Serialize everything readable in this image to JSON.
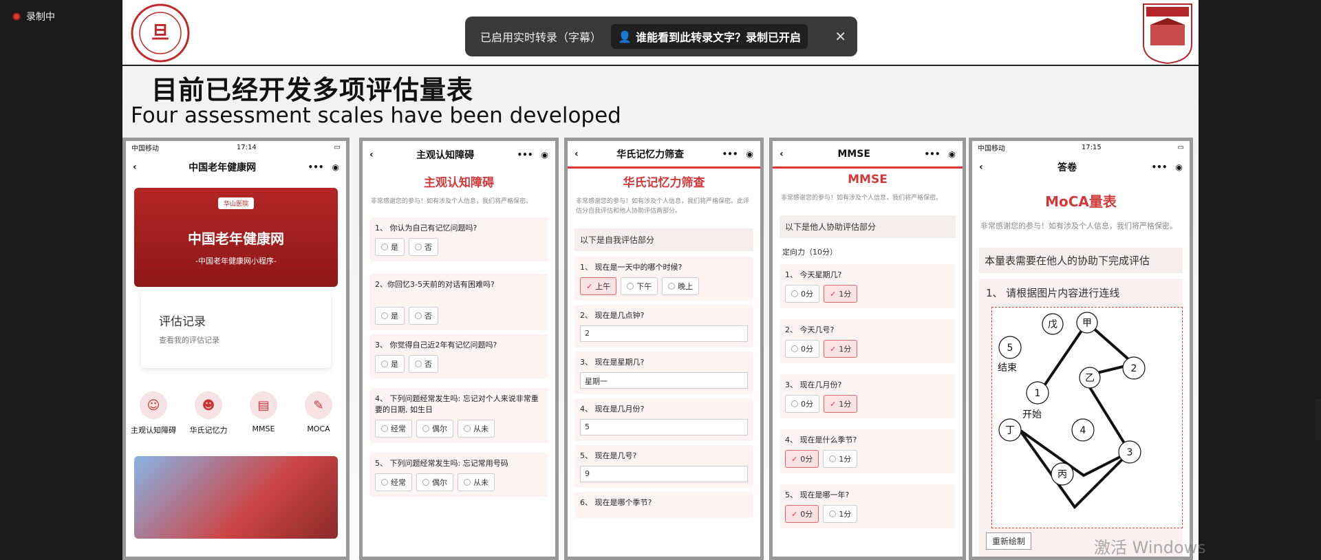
{
  "recording": {
    "label": "录制中"
  },
  "banner": {
    "status": "已启用实时转录（字幕）",
    "question": "谁能看到此转录文字？录制已开启",
    "close": "✕"
  },
  "slide": {
    "title_cn": "目前已经开发多项评估量表",
    "title_en": "Four assessment scales have been developed",
    "logo_left_text": "FUDAN UNIVERSITY",
    "logo_left_year": "1905",
    "logo_right_text": "HUASHAN HOSPITAL"
  },
  "phone1": {
    "status": {
      "carrier": "中国移动",
      "time": "17:14"
    },
    "nav_title": "中国老年健康网",
    "card": {
      "badge": "华山医院",
      "title": "中国老年健康网",
      "subtitle": "-中国老年健康网小程序-"
    },
    "record": {
      "title": "评估记录",
      "sub": "查看我的评估记录"
    },
    "icons": [
      {
        "label": "主观认知障碍"
      },
      {
        "label": "华氏记忆力"
      },
      {
        "label": "MMSE"
      },
      {
        "label": "MOCA"
      }
    ]
  },
  "phone2": {
    "nav_title": "主观认知障碍",
    "title": "主观认知障碍",
    "intro": "非常感谢您的参与！如有涉及个人信息，我们将严格保密。",
    "questions": [
      {
        "text": "1、 你认为自己有记忆问题吗?",
        "options": [
          "是",
          "否"
        ]
      },
      {
        "text": "2、你回忆3-5天前的对话有困难吗?",
        "options": [
          "是",
          "否"
        ]
      },
      {
        "text": "3、 你觉得自己近2年有记忆问题吗?",
        "options": [
          "是",
          "否"
        ]
      },
      {
        "text": "4、 下列问题经常发生吗: 忘记对个人来说非常重要的日期, 如生日",
        "options": [
          "经常",
          "偶尔",
          "从未"
        ]
      },
      {
        "text": "5、 下列问题经常发生吗: 忘记常用号码",
        "options": [
          "经常",
          "偶尔",
          "从未"
        ]
      }
    ]
  },
  "phone3": {
    "nav_title": "华氏记忆力筛查",
    "title": "华氏记忆力筛查",
    "intro": "非常感谢您的参与！如有涉及个人信息，我们将严格保密。此评估分自我评估和他人协助评估两部分。",
    "section": "以下是自我评估部分",
    "q1": {
      "text": "1、 现在是一天中的哪个时候?",
      "options": [
        "上午",
        "下午",
        "晚上"
      ]
    },
    "inputs": [
      {
        "text": "2、 现在是几点钟?",
        "value": "2"
      },
      {
        "text": "3、 现在是星期几?",
        "value": "星期一"
      },
      {
        "text": "4、 现在是几月份?",
        "value": "5"
      },
      {
        "text": "5、 现在是几号?",
        "value": "9"
      }
    ],
    "q6": "6、 现在是哪个季节?"
  },
  "phone4": {
    "nav_title": "MMSE",
    "title": "MMSE",
    "intro": "非常感谢您的参与！如有涉及个人信息，我们将严格保密。",
    "section": "以下是他人协助评估部分",
    "sub": "定向力（10分）",
    "questions": [
      {
        "text": "1、 今天星期几?",
        "options": [
          "0分",
          "1分"
        ]
      },
      {
        "text": "2、 今天几号?",
        "options": [
          "0分",
          "1分"
        ]
      },
      {
        "text": "3、 现在几月份?",
        "options": [
          "0分",
          "1分"
        ]
      },
      {
        "text": "4、 现在是什么季节?",
        "options": [
          "0分",
          "1分"
        ]
      },
      {
        "text": "5、 现在是哪一年?",
        "options": [
          "0分",
          "1分"
        ]
      }
    ]
  },
  "phone5": {
    "status": {
      "carrier": "中国移动",
      "time": "17:15"
    },
    "nav_title": "答卷",
    "title": "MoCA量表",
    "intro": "非常感谢您的参与！如有涉及个人信息，我们将严格保密。",
    "note": "本量表需要在他人的协助下完成评估",
    "q1": "1、 请根据图片内容进行连线",
    "nodes": {
      "n5": "5",
      "wu": "戊",
      "jia": "甲",
      "n2": "2",
      "yi": "乙",
      "n1": "1",
      "ding": "丁",
      "n4": "4",
      "n3": "3",
      "bing": "丙"
    },
    "end_label": "结束",
    "start_label": "开始",
    "redraw": "重新绘制"
  },
  "watermark": "激活 Windows",
  "check": "✓"
}
